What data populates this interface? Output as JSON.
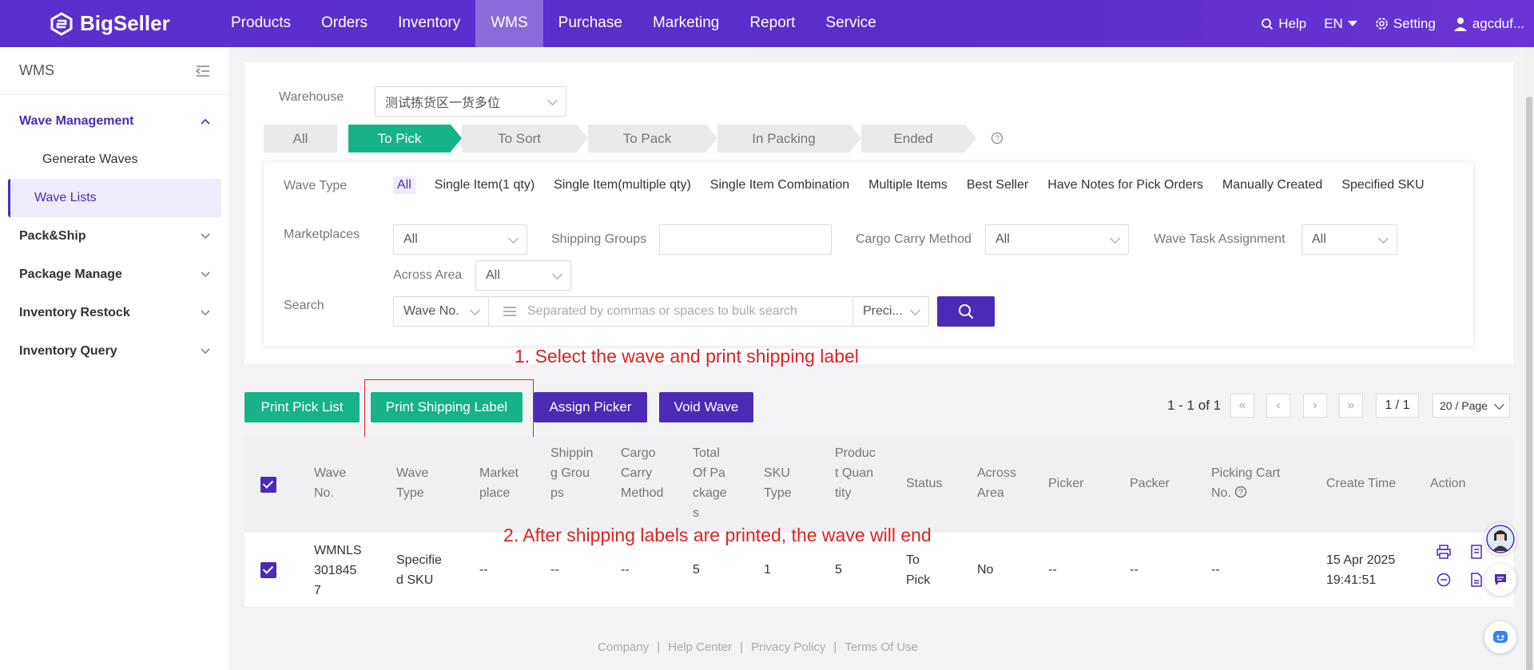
{
  "app": {
    "logo_text": "BigSeller"
  },
  "nav": {
    "items": [
      "Products",
      "Orders",
      "Inventory",
      "WMS",
      "Purchase",
      "Marketing",
      "Report",
      "Service"
    ],
    "active": "WMS",
    "help": "Help",
    "lang": "EN",
    "setting": "Setting",
    "user": "agcduf..."
  },
  "sidebar": {
    "title": "WMS",
    "groups": [
      {
        "label": "Wave Management",
        "open": true,
        "subs": [
          "Generate Waves",
          "Wave Lists"
        ]
      },
      {
        "label": "Pack&Ship"
      },
      {
        "label": "Package Manage"
      },
      {
        "label": "Inventory Restock"
      },
      {
        "label": "Inventory Query"
      }
    ],
    "active_sub": "Wave Lists"
  },
  "warehouse": {
    "label": "Warehouse",
    "value": "测试拣货区一货多位"
  },
  "status_tabs": [
    "All",
    "To Pick",
    "To Sort",
    "To Pack",
    "In Packing",
    "Ended"
  ],
  "active_tab": "To Pick",
  "filters": {
    "wave_type_label": "Wave Type",
    "wave_types": [
      "All",
      "Single Item(1 qty)",
      "Single Item(multiple qty)",
      "Single Item Combination",
      "Multiple Items",
      "Best Seller",
      "Have Notes for Pick Orders",
      "Manually Created",
      "Specified SKU"
    ],
    "marketplaces_label": "Marketplaces",
    "marketplaces_value": "All",
    "shipping_groups_label": "Shipping Groups",
    "cargo_label": "Cargo Carry Method",
    "cargo_value": "All",
    "assign_label": "Wave Task Assignment",
    "assign_value": "All",
    "across_label": "Across Area",
    "across_value": "All",
    "search_label": "Search",
    "search_field": "Wave No.",
    "search_placeholder": "Separated by commas or spaces to bulk search",
    "search_mode": "Preci..."
  },
  "annotations": {
    "note1": "1. Select the wave and print shipping label",
    "note2": "2. After shipping labels are printed, the wave will end"
  },
  "actions": {
    "print_pick": "Print Pick List",
    "print_label": "Print Shipping Label",
    "assign_picker": "Assign Picker",
    "void_wave": "Void Wave"
  },
  "pager": {
    "range": "1 - 1 of 1",
    "page": "1 / 1",
    "per_page": "20 / Page"
  },
  "table": {
    "headers": {
      "wave_no": "Wave No.",
      "wave_type": "Wave Type",
      "marketplace": "Marketplace",
      "shipping_groups": "Shipping Groups",
      "cargo": "Cargo Carry Method",
      "packages": "Total Of Packages",
      "sku_type": "SKU Type",
      "product_qty": "Product Quantity",
      "status": "Status",
      "across": "Across Area",
      "picker": "Picker",
      "packer": "Packer",
      "cart": "Picking Cart No.",
      "create_time": "Create Time",
      "action": "Action"
    },
    "rows": [
      {
        "wave_no": "WMNLS3018457",
        "wave_type": "Specified SKU",
        "marketplace": "--",
        "shipping_groups": "--",
        "cargo": "--",
        "packages": "5",
        "sku_type": "1",
        "product_qty": "5",
        "status": "To Pick",
        "across": "No",
        "picker": "--",
        "packer": "--",
        "cart": "--",
        "create_date": "15 Apr 2025",
        "create_clock": "19:41:51"
      }
    ]
  },
  "footer": [
    "Company",
    "Help Center",
    "Privacy Policy",
    "Terms Of Use"
  ],
  "colors": {
    "brand": "#5b2fcf",
    "accent_green": "#17b388",
    "annotation_red": "#e02020"
  }
}
